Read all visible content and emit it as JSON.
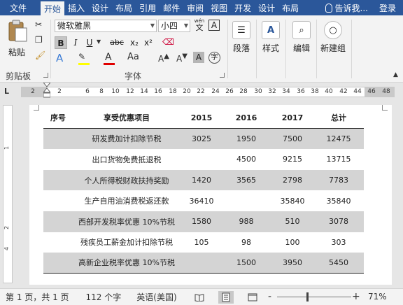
{
  "tabs": [
    "文件",
    "开始",
    "插入",
    "设计",
    "布局",
    "引用",
    "邮件",
    "审阅",
    "视图",
    "开发",
    "设计",
    "布局"
  ],
  "active_tab": "开始",
  "tell_me": "告诉我...",
  "login": "登录",
  "ribbon": {
    "clipboard": {
      "paste_label": "粘贴",
      "group_label": "剪贴板"
    },
    "font": {
      "font_name": "微软雅黑",
      "font_size": "小四",
      "wen_glyph": "wén",
      "wen_char": "文",
      "bold": "B",
      "italic": "I",
      "underline": "U",
      "strike": "abc",
      "subscript": "x₂",
      "superscript": "x²",
      "case": "Aa",
      "group_label": "字体"
    },
    "paragraph_label": "段落",
    "styles_label": "样式",
    "editing_label": "编辑",
    "newgroup_label": "新建组"
  },
  "ruler": {
    "tab_selector": "L",
    "numbers": [
      "2",
      "2",
      "6",
      "8",
      "10",
      "12",
      "14",
      "16",
      "18",
      "20",
      "22",
      "24",
      "26",
      "28",
      "30",
      "32",
      "34",
      "36",
      "38",
      "40",
      "42",
      "44",
      "46",
      "48"
    ]
  },
  "table": {
    "headers": [
      "序号",
      "享受优惠项目",
      "2015",
      "2016",
      "2017",
      "总计"
    ],
    "rows": [
      [
        "",
        "研发费加计扣除节税",
        "3025",
        "1950",
        "7500",
        "12475"
      ],
      [
        "",
        "出口货物免费抵退税",
        "",
        "4500",
        "9215",
        "13715"
      ],
      [
        "",
        "个人所得税财政扶持奖励",
        "1420",
        "3565",
        "2798",
        "7783"
      ],
      [
        "",
        "生产自用油消费税返还款",
        "36410",
        "",
        "35840",
        "35840"
      ],
      [
        "",
        "西部开发税率优惠 10%节税",
        "1580",
        "988",
        "510",
        "3078"
      ],
      [
        "",
        "残疾员工薪金加计扣除节税",
        "105",
        "98",
        "100",
        "303"
      ],
      [
        "",
        "高新企业税率优惠 10%节税",
        "",
        "1500",
        "3950",
        "5450"
      ]
    ]
  },
  "status": {
    "page": "第 1 页，共 1 页",
    "words": "112 个字",
    "language": "英语(美国)",
    "zoom": "71%",
    "zoom_minus": "-",
    "zoom_plus": "+"
  },
  "colors": {
    "accent": "#2b579a",
    "shade": "#d4d4d4"
  }
}
